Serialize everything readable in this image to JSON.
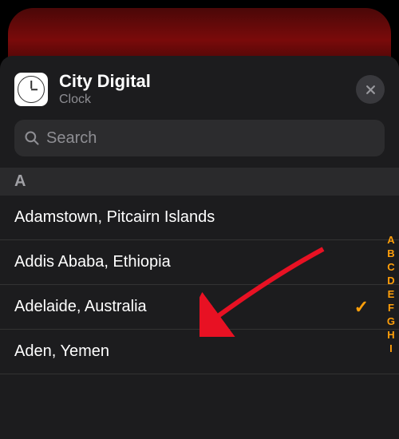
{
  "header": {
    "title": "City Digital",
    "subtitle": "Clock"
  },
  "search": {
    "placeholder": "Search",
    "value": ""
  },
  "section": {
    "letter": "A"
  },
  "cities": [
    {
      "name": "Adamstown, Pitcairn Islands",
      "selected": false
    },
    {
      "name": "Addis Ababa, Ethiopia",
      "selected": false
    },
    {
      "name": "Adelaide, Australia",
      "selected": true
    },
    {
      "name": "Aden, Yemen",
      "selected": false
    }
  ],
  "index_letters": [
    "A",
    "B",
    "C",
    "D",
    "E",
    "F",
    "G",
    "H",
    "I"
  ],
  "colors": {
    "accent": "#ff9f0a",
    "sheet_bg": "#1c1c1e",
    "search_bg": "#2c2c2e"
  }
}
